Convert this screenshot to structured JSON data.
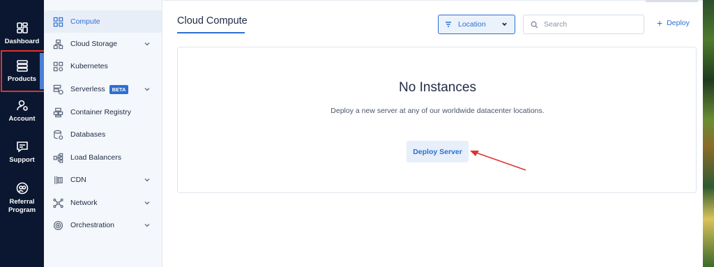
{
  "rail": {
    "items": [
      {
        "label": "Dashboard",
        "icon": "dashboard-icon"
      },
      {
        "label": "Products",
        "icon": "products-icon"
      },
      {
        "label": "Account",
        "icon": "account-icon"
      },
      {
        "label": "Support",
        "icon": "support-icon"
      },
      {
        "label": "Referral Program",
        "icon": "referral-icon"
      }
    ]
  },
  "sidebar": {
    "items": [
      {
        "label": "Compute",
        "icon": "compute-icon",
        "expandable": false,
        "active": true
      },
      {
        "label": "Cloud Storage",
        "icon": "storage-icon",
        "expandable": true
      },
      {
        "label": "Kubernetes",
        "icon": "kubernetes-icon",
        "expandable": false
      },
      {
        "label": "Serverless",
        "icon": "serverless-icon",
        "expandable": true,
        "badge": "BETA"
      },
      {
        "label": "Container Registry",
        "icon": "container-icon",
        "expandable": false
      },
      {
        "label": "Databases",
        "icon": "database-icon",
        "expandable": false
      },
      {
        "label": "Load Balancers",
        "icon": "loadbalancer-icon",
        "expandable": false
      },
      {
        "label": "CDN",
        "icon": "cdn-icon",
        "expandable": true
      },
      {
        "label": "Network",
        "icon": "network-icon",
        "expandable": true
      },
      {
        "label": "Orchestration",
        "icon": "orchestration-icon",
        "expandable": true
      }
    ]
  },
  "header": {
    "title": "Cloud Compute",
    "location_label": "Location",
    "search_placeholder": "Search",
    "deploy_label": "Deploy"
  },
  "empty_state": {
    "title": "No Instances",
    "subtitle": "Deploy a new server at any of our worldwide datacenter locations.",
    "button_label": "Deploy Server"
  },
  "colors": {
    "rail_bg": "#0b1730",
    "accent": "#2d6fd1",
    "highlight_box": "#e0332e",
    "annotation_arrow": "#e0332e"
  }
}
